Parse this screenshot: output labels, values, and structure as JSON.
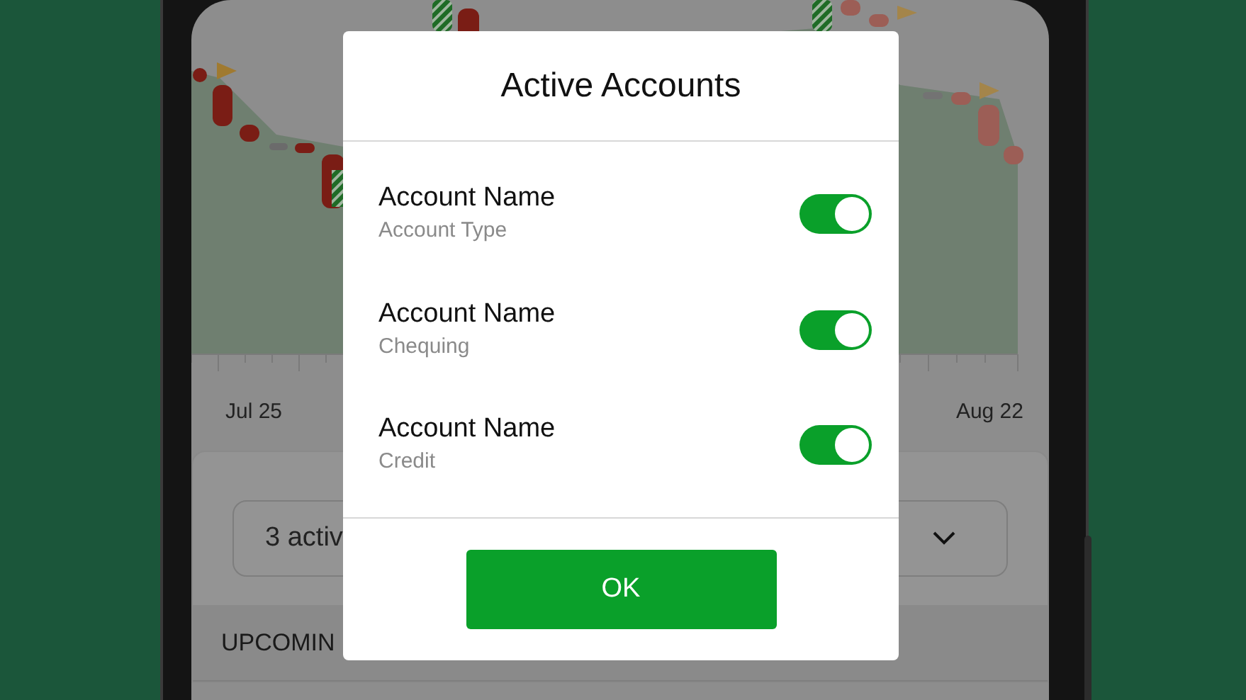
{
  "chart": {
    "x_labels": [
      "Jul 25",
      "Aug 22"
    ]
  },
  "account_filter": {
    "value": "3 activ"
  },
  "section_header": "UPCOMIN",
  "dialog": {
    "title": "Active Accounts",
    "accounts": [
      {
        "name": "Account Name",
        "type": "Account Type",
        "on": true
      },
      {
        "name": "Account Name",
        "type": "Chequing",
        "on": true
      },
      {
        "name": "Account Name",
        "type": "Credit",
        "on": true
      }
    ],
    "ok_button": "OK"
  }
}
